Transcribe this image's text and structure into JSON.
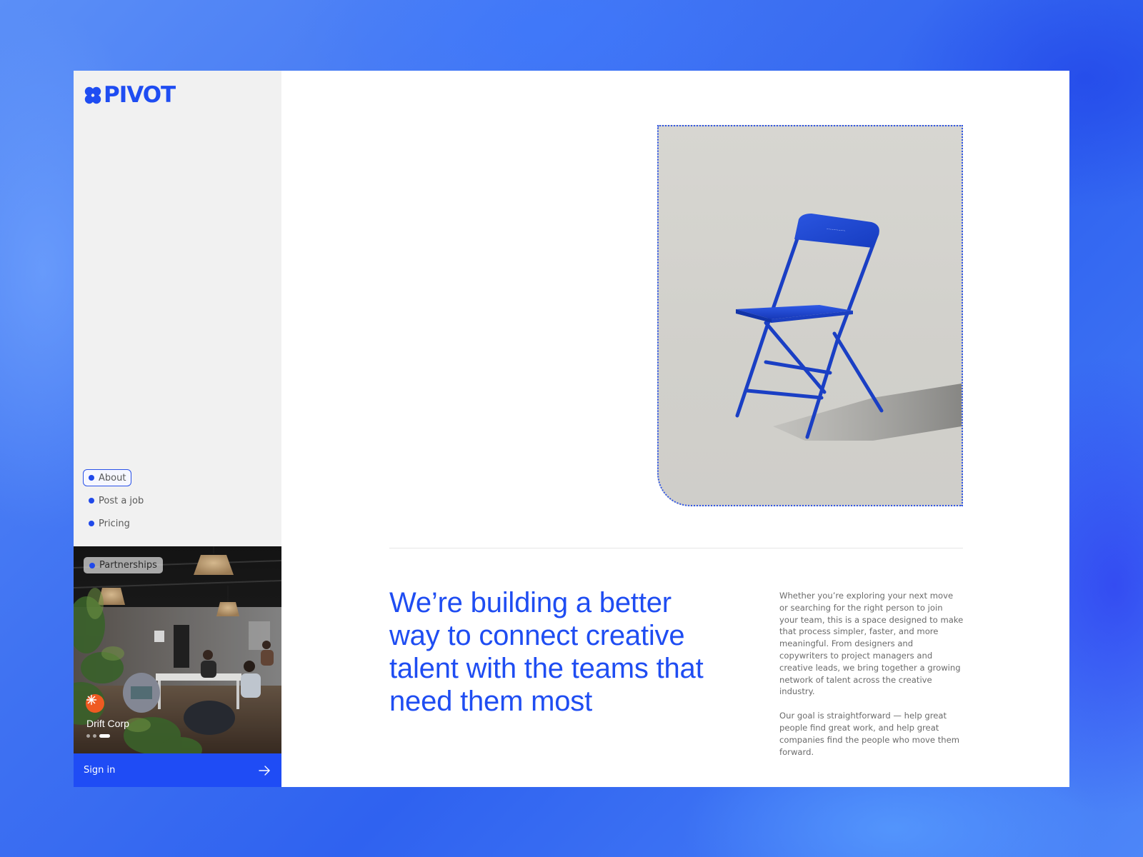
{
  "brand": {
    "name": "PIVOT",
    "accent_color": "#1f4df2",
    "logo_icon": "clover-icon"
  },
  "nav": {
    "items": [
      {
        "label": "About",
        "active": true
      },
      {
        "label": "Post a job",
        "active": false
      },
      {
        "label": "Pricing",
        "active": false
      }
    ]
  },
  "featured": {
    "chip_label": "Partnerships",
    "company_name": "Drift Corp",
    "company_icon": "sunburst-icon",
    "slides_total": 3,
    "slide_active": 3
  },
  "signin": {
    "label": "Sign in",
    "icon": "arrow-right-icon"
  },
  "hero": {
    "image_subject": "chair-icon",
    "headline": "We’re building a better way to connect creative talent with the teams that need them most",
    "paragraphs": [
      "Whether you’re exploring your next move or searching for the right person to join your team, this is a space designed to make that process simpler, faster, and more meaningful. From designers and copywriters to project managers and creative leads, we bring together a growing network of talent across the creative industry.",
      "Our goal is straightforward — help great people find great work, and help great companies find the people who move them forward."
    ]
  }
}
